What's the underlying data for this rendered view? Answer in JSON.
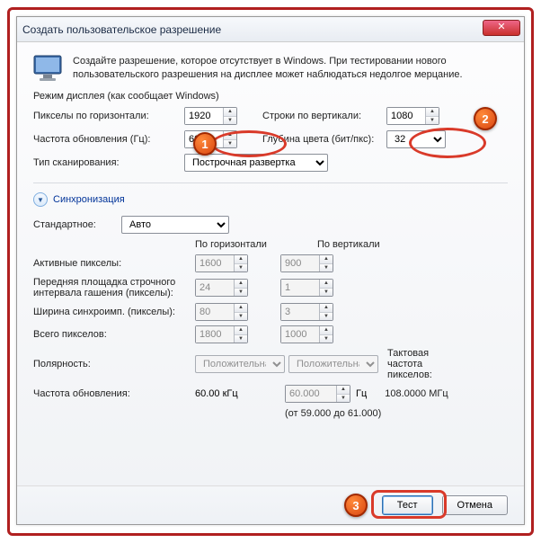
{
  "window": {
    "title": "Создать пользовательское разрешение"
  },
  "intro": "Создайте разрешение, которое отсутствует в Windows. При тестировании нового пользовательского разрешения на дисплее может наблюдаться недолгое мерцание.",
  "mode": {
    "group": "Режим дисплея (как сообщает Windows)",
    "h_pixels_label": "Пикселы по горизонтали:",
    "h_pixels": "1920",
    "v_lines_label": "Строки по вертикали:",
    "v_lines": "1080",
    "refresh_label": "Частота обновления (Гц):",
    "refresh": "60",
    "depth_label": "Глубина цвета (бит/пкс):",
    "depth": "32",
    "scan_label": "Тип сканирования:",
    "scan": "Построчная развертка"
  },
  "sync": {
    "title": "Синхронизация",
    "std_label": "Стандартное:",
    "std": "Авто",
    "col_h": "По горизонтали",
    "col_v": "По вертикали",
    "active_label": "Активные пикселы:",
    "active_h": "1600",
    "active_v": "900",
    "porch_label": "Передняя площадка строчного интервала гашения (пикселы):",
    "porch_h": "24",
    "porch_v": "1",
    "width_label": "Ширина синхроимп. (пикселы):",
    "width_h": "80",
    "width_v": "3",
    "total_label": "Всего пикселов:",
    "total_h": "1800",
    "total_v": "1000",
    "polarity_label": "Полярность:",
    "polarity_h": "Положительная",
    "polarity_v": "Положительная",
    "refresh2_label": "Частота обновления:",
    "refresh_khz": "60.00 кГц",
    "refresh_hz": "60.000",
    "hz_unit": "Гц",
    "range": "(от 59.000 до 61.000)",
    "pclk_label": "Тактовая частота пикселов:",
    "pclk": "108.0000 МГц"
  },
  "buttons": {
    "test": "Тест",
    "cancel": "Отмена"
  },
  "badges": {
    "b1": "1",
    "b2": "2",
    "b3": "3"
  }
}
